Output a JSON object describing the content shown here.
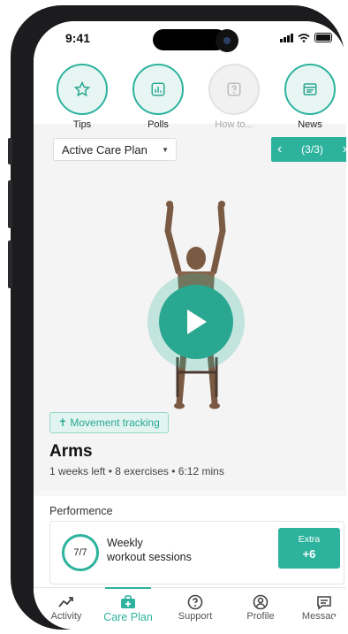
{
  "status_bar": {
    "time": "9:41"
  },
  "quick_actions": [
    {
      "label": "Tips",
      "icon": "star-icon"
    },
    {
      "label": "Polls",
      "icon": "poll-icon"
    },
    {
      "label": "How to...",
      "icon": "question-icon",
      "disabled": true
    },
    {
      "label": "News",
      "icon": "news-icon"
    }
  ],
  "plan_selector": {
    "selected": "Active Care Plan"
  },
  "pager": {
    "prev": "‹",
    "label": "(3/3)",
    "next": "›"
  },
  "exercise": {
    "tag": "✝ Movement tracking",
    "title": "Arms",
    "meta": "1 weeks left  •  8 exercises  •  6:12 mins"
  },
  "performance": {
    "label": "Performence",
    "ring_value": "7/7",
    "line1": "Weekly",
    "line2": "workout sessions",
    "extra_label": "Extra",
    "extra_value": "+6"
  },
  "tabs": [
    {
      "label": "Activity",
      "icon": "activity-icon"
    },
    {
      "label": "Care Plan",
      "icon": "care-plan-icon",
      "active": true
    },
    {
      "label": "Support",
      "icon": "support-icon"
    },
    {
      "label": "Profile",
      "icon": "profile-icon"
    },
    {
      "label": "Messages",
      "icon": "messages-icon"
    }
  ],
  "colors": {
    "accent": "#2db39d",
    "accent_dark": "#2aa791",
    "background": "#f3f4f3"
  }
}
